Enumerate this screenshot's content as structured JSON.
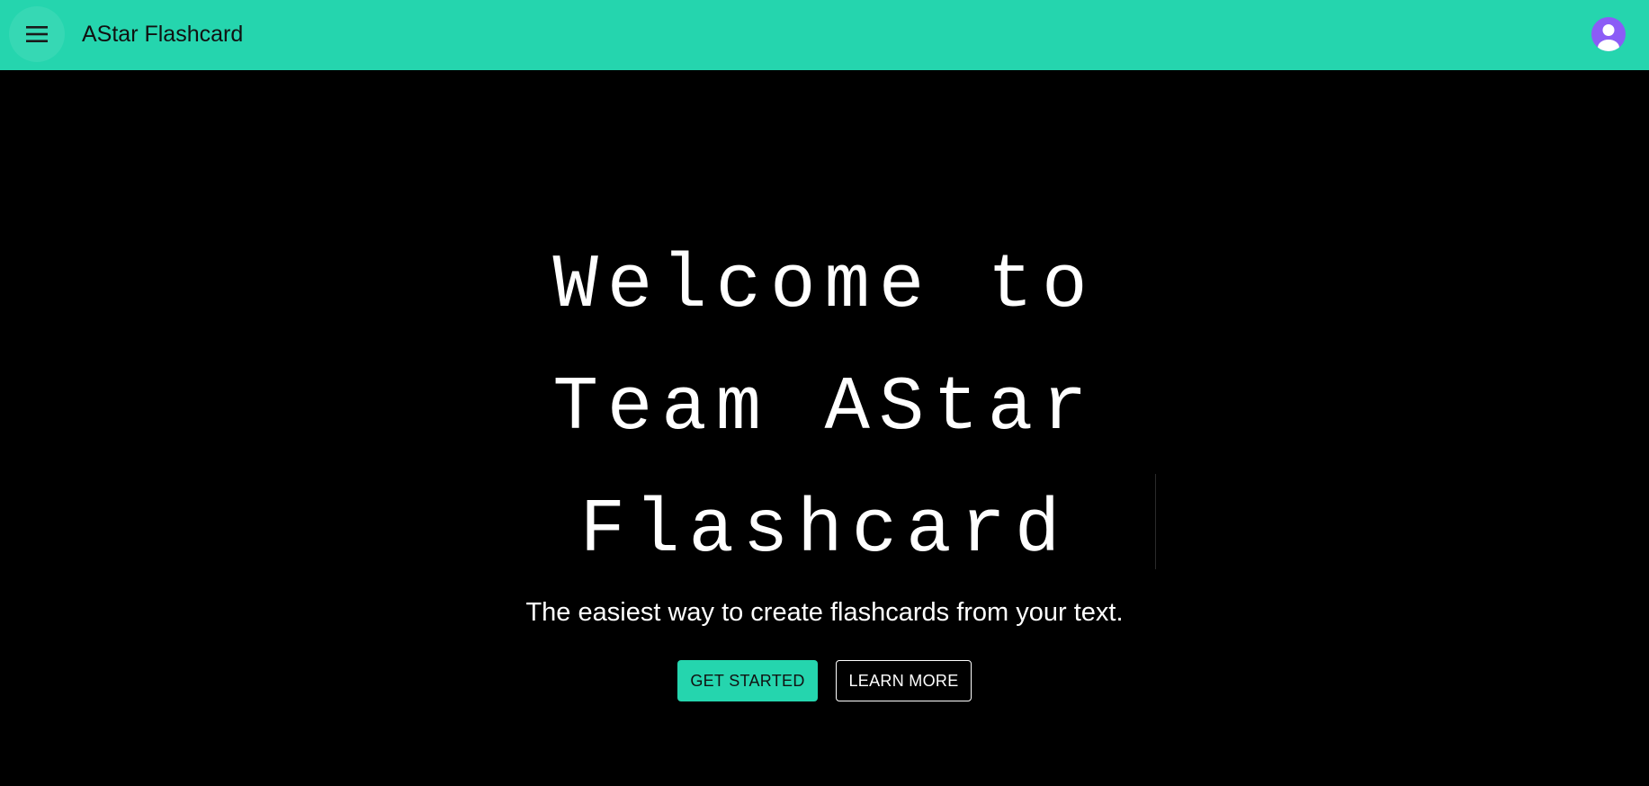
{
  "colors": {
    "accent": "#25d5ae",
    "background": "#000000",
    "avatar": "#8b5cf6"
  },
  "appbar": {
    "menu_icon": "hamburger-menu-icon",
    "title": "AStar Flashcard",
    "avatar_icon": "user-avatar-icon"
  },
  "hero": {
    "title_lines": [
      "Welcome to",
      "Team AStar",
      "Flashcard"
    ],
    "subtitle": "The easiest way to create flashcards from your text.",
    "primary_button": "GET STARTED",
    "secondary_button": "LEARN MORE"
  }
}
